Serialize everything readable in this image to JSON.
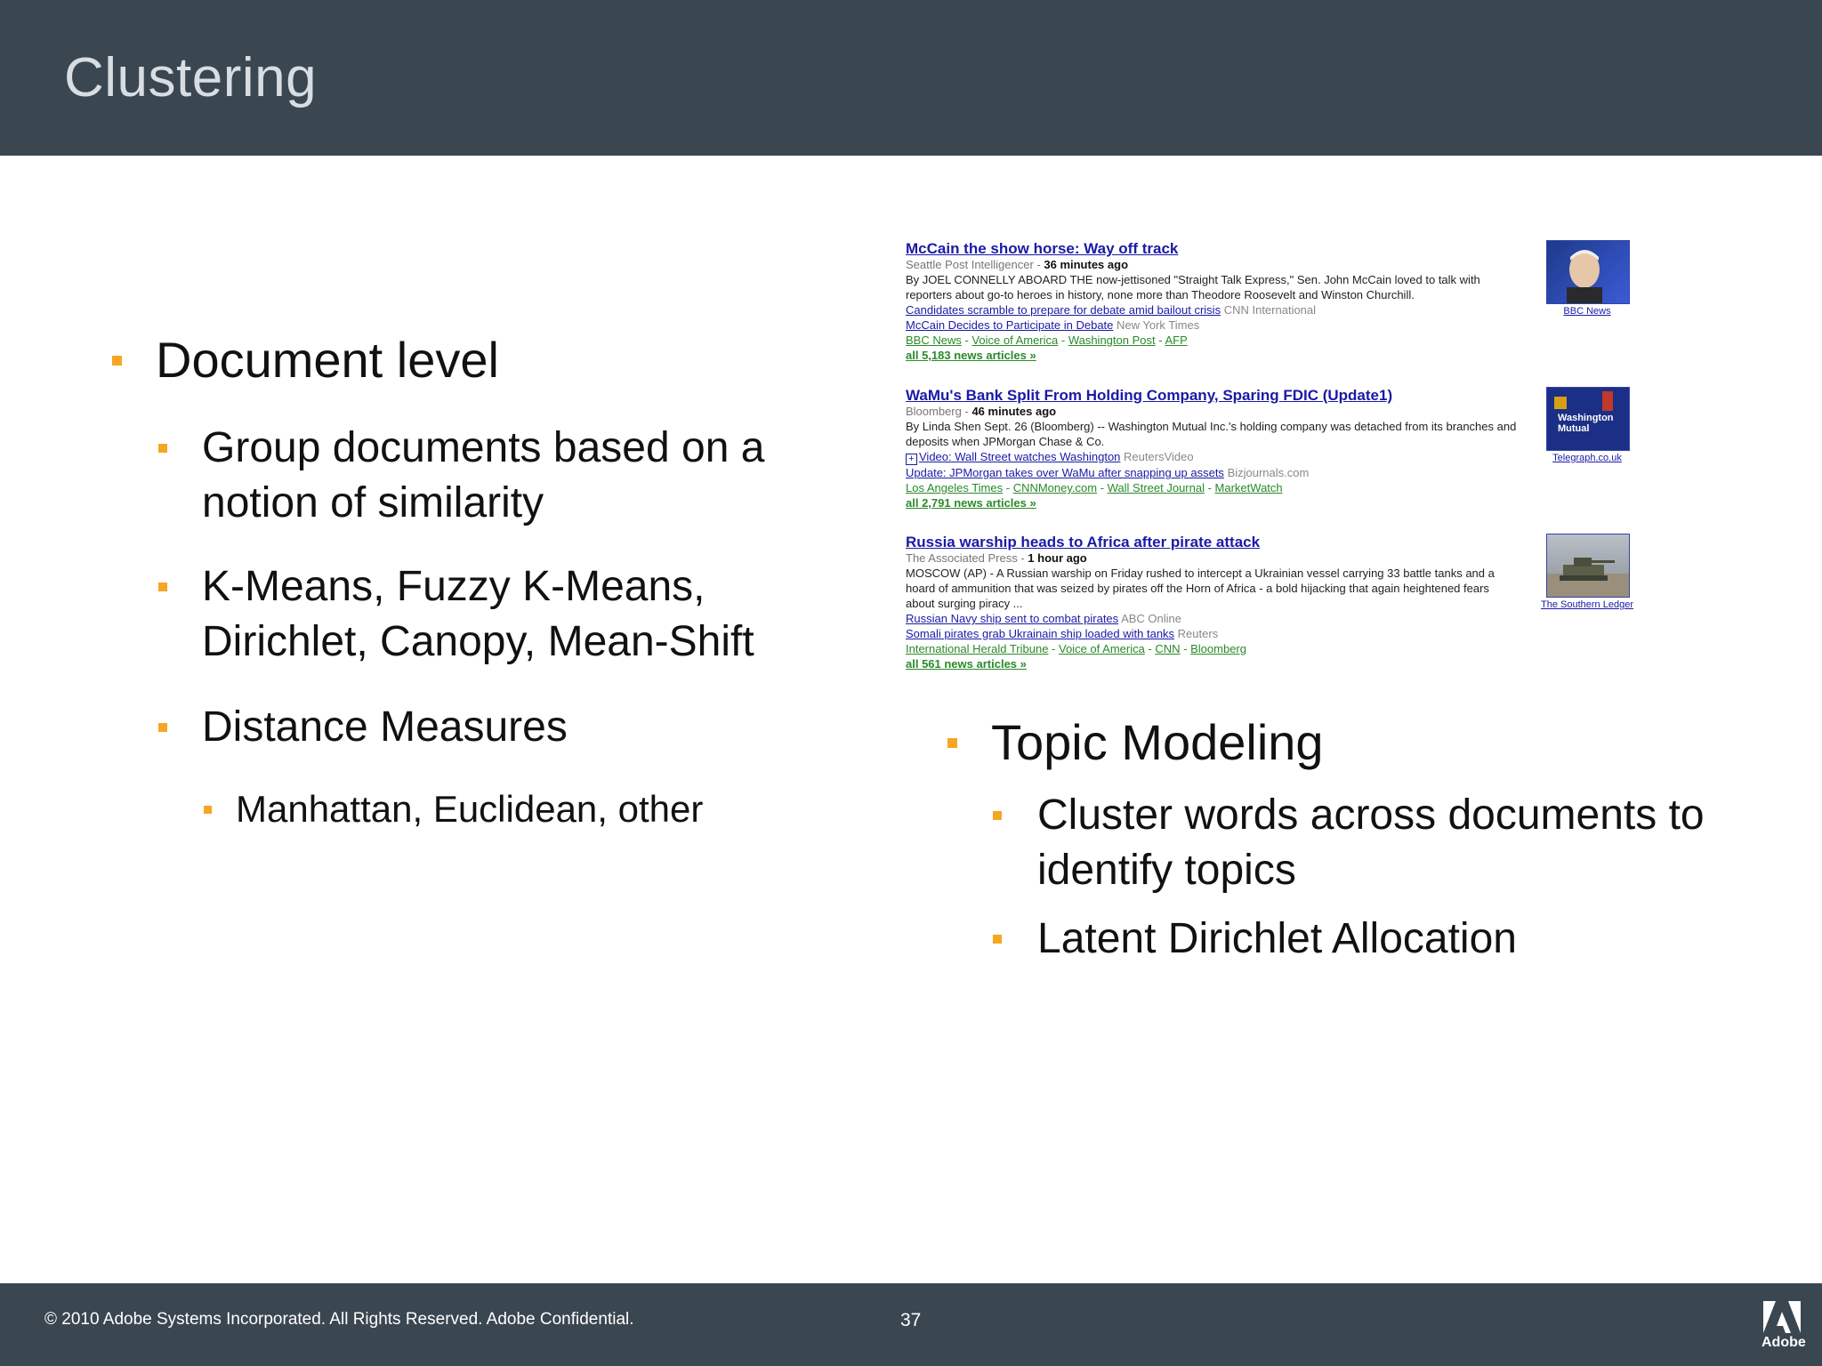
{
  "slide": {
    "title": "Clustering",
    "page_number": "37",
    "copyright": "© 2010 Adobe Systems Incorporated.  All Rights Reserved.  Adobe Confidential.",
    "logo_text": "Adobe"
  },
  "left_bullets": {
    "b1": "Document level",
    "b1_1": "Group documents based on a notion of similarity",
    "b1_2": "K-Means, Fuzzy K-Means, Dirichlet, Canopy, Mean-Shift",
    "b1_3": "Distance Measures",
    "b1_3_1": "Manhattan, Euclidean, other"
  },
  "right_bullets": {
    "b2": "Topic Modeling",
    "b2_1": "Cluster words across documents to identify topics",
    "b2_2": "Latent Dirichlet Allocation"
  },
  "news": [
    {
      "title": "McCain the show horse: Way off track",
      "source": "Seattle Post Intelligencer",
      "time": "36 minutes ago",
      "snippet": "By JOEL CONNELLY ABOARD THE now-jettisoned \"Straight Talk Express,\" Sen. John McCain loved to talk with reporters about go-to heroes in history, none more than Theodore Roosevelt and Winston Churchill.",
      "related": [
        {
          "link": "Candidates scramble to prepare for debate amid bailout crisis",
          "source": "CNN International"
        },
        {
          "link": "McCain Decides to Participate in Debate",
          "source": "New York Times"
        }
      ],
      "more_sources": [
        "BBC News",
        "Voice of America",
        "Washington Post",
        "AFP"
      ],
      "all_articles": "all 5,183 news articles »",
      "image_caption": "BBC News"
    },
    {
      "title": "WaMu's Bank Split From Holding Company, Sparing FDIC (Update1)",
      "source": "Bloomberg",
      "time": "46 minutes ago",
      "snippet": "By Linda Shen Sept. 26 (Bloomberg) -- Washington Mutual Inc.'s holding company was detached from its branches and deposits when JPMorgan Chase & Co.",
      "video": {
        "link": "Video: Wall Street watches Washington",
        "source": "ReutersVideo"
      },
      "related": [
        {
          "link": "Update: JPMorgan takes over WaMu after snapping up assets",
          "source": "Bizjournals.com"
        }
      ],
      "more_sources": [
        "Los Angeles Times",
        "CNNMoney.com",
        "Wall Street Journal",
        "MarketWatch"
      ],
      "all_articles": "all 2,791 news articles »",
      "image_caption": "Telegraph.co.uk",
      "image_text": "Washington Mutual"
    },
    {
      "title": "Russia warship heads to Africa after pirate attack",
      "source": "The Associated Press",
      "time": "1 hour ago",
      "snippet": "MOSCOW (AP) - A Russian warship on Friday rushed to intercept a Ukrainian vessel carrying 33 battle tanks and a hoard of ammunition that was seized by pirates off the Horn of Africa - a bold hijacking that again heightened fears about surging piracy ...",
      "related": [
        {
          "link": "Russian Navy ship sent to combat pirates",
          "source": "ABC Online"
        },
        {
          "link": "Somali pirates grab Ukrainain ship loaded with tanks",
          "source": "Reuters"
        }
      ],
      "more_sources": [
        "International Herald Tribune",
        "Voice of America",
        "CNN",
        "Bloomberg"
      ],
      "all_articles": "all 561 news articles »",
      "image_caption": "The Southern Ledger"
    }
  ],
  "colors": {
    "header_bg": "#3a4650",
    "bullet": "#f5a623",
    "link_blue": "#1a1aa6",
    "link_green": "#2a8a2a"
  }
}
